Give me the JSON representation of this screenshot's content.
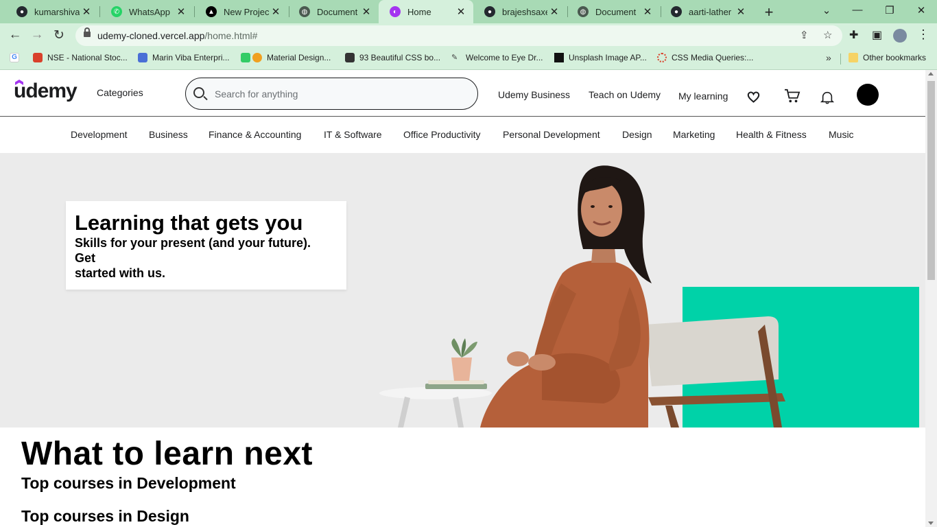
{
  "browser": {
    "tabs": [
      {
        "title": "kumarshivam",
        "icon": "github-icon",
        "active": false
      },
      {
        "title": "WhatsApp",
        "icon": "whatsapp-icon",
        "active": false
      },
      {
        "title": "New Project -",
        "icon": "vercel-icon",
        "active": false
      },
      {
        "title": "Document",
        "icon": "globe-icon",
        "active": false
      },
      {
        "title": "Home",
        "icon": "clip-icon",
        "active": true
      },
      {
        "title": "brajeshsaxena",
        "icon": "github-icon",
        "active": false
      },
      {
        "title": "Document",
        "icon": "globe-icon",
        "active": false
      },
      {
        "title": "aarti-lather (A",
        "icon": "github-icon",
        "active": false
      }
    ],
    "url_host": "udemy-cloned.vercel.app",
    "url_path": "/home.html#",
    "bookmarks": [
      {
        "label": "NSE - National Stoc...",
        "color": "#d9412b"
      },
      {
        "label": "Marin Viba Enterpri...",
        "color": "#4a6fd6"
      },
      {
        "label": "Material Design...",
        "color": "#f0a020"
      },
      {
        "label": "93 Beautiful CSS bo...",
        "color": "#333333"
      },
      {
        "label": "Welcome to Eye Dr...",
        "color": "#666666"
      },
      {
        "label": "Unsplash Image AP...",
        "color": "#111111"
      },
      {
        "label": "CSS Media Queries:...",
        "color": "#d9412b"
      }
    ],
    "other_bookmarks": "Other bookmarks"
  },
  "header": {
    "logo": "udemy",
    "categories": "Categories",
    "search_placeholder": "Search for anything",
    "links": [
      "Udemy Business",
      "Teach on Udemy",
      "My learning"
    ]
  },
  "categories_nav": [
    "Development",
    "Business",
    "Finance & Accounting",
    "IT & Software",
    "Office Productivity",
    "Personal Development",
    "Design",
    "Marketing",
    "Health & Fitness",
    "Music"
  ],
  "hero": {
    "title": "Learning that gets you",
    "subtitle_line1": "Skills for your present (and your future).",
    "subtitle_line2": "Get",
    "subtitle_line3": "started with us."
  },
  "main": {
    "section_title": "What to learn next",
    "subsections": [
      "Top courses in Development",
      "Top courses in Design"
    ]
  },
  "colors": {
    "brand_purple": "#a435f0",
    "teal": "#00d2a8",
    "chrome_green": "#a8dab5"
  }
}
